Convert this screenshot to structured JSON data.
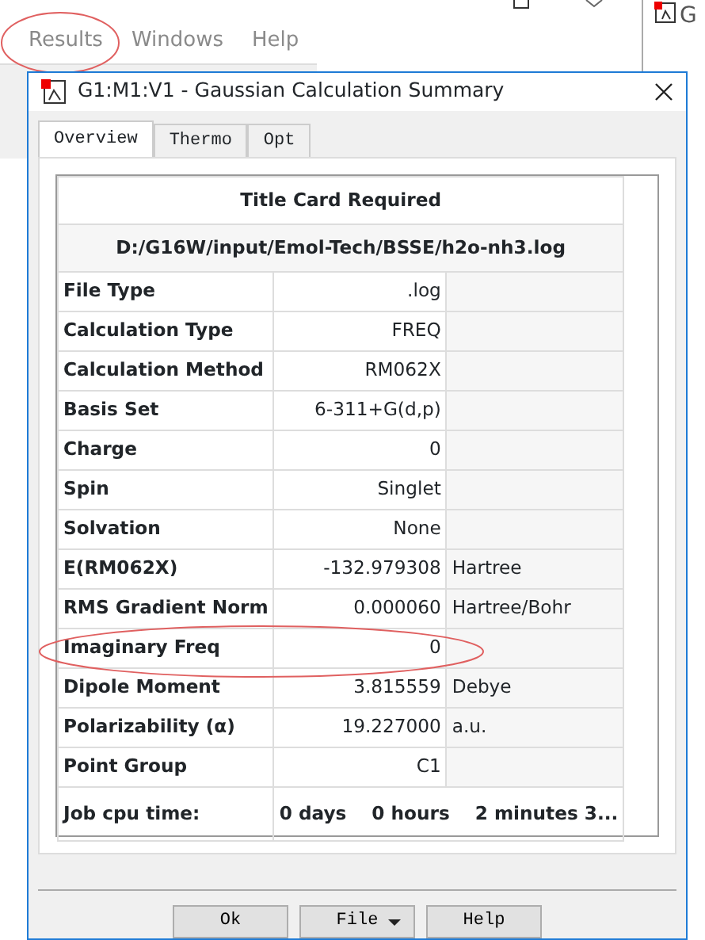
{
  "app_window": {
    "menu": [
      {
        "label": "Results",
        "circled": true
      },
      {
        "label": "Windows",
        "circled": false
      },
      {
        "label": "Help",
        "circled": false
      }
    ]
  },
  "side_window": {
    "title": "G"
  },
  "dialog": {
    "title": "G1:M1:V1 - Gaussian Calculation Summary",
    "tabs": [
      {
        "label": "Overview",
        "selected": true
      },
      {
        "label": "Thermo",
        "selected": false
      },
      {
        "label": "Opt",
        "selected": false
      }
    ],
    "rows": [
      {
        "kind": "header",
        "text": "Title Card Required"
      },
      {
        "kind": "path",
        "text": "D:/G16W/input/Emol-Tech/BSSE/h2o-nh3.log"
      },
      {
        "kind": "field",
        "label": "File Type",
        "value": ".log"
      },
      {
        "kind": "field",
        "label": "Calculation Type",
        "value": "FREQ"
      },
      {
        "kind": "field",
        "label": "Calculation Method",
        "value": "RM062X"
      },
      {
        "kind": "field",
        "label": "Basis Set",
        "value": "6-311+G(d,p)"
      },
      {
        "kind": "field",
        "label": "Charge",
        "value": "0"
      },
      {
        "kind": "field",
        "label": "Spin",
        "value": "Singlet"
      },
      {
        "kind": "field",
        "label": "Solvation",
        "value": "None"
      },
      {
        "kind": "field",
        "label": "E(RM062X)",
        "value": "-132.979308",
        "unit": "Hartree"
      },
      {
        "kind": "field",
        "label": "RMS Gradient Norm",
        "value": "0.000060",
        "unit": "Hartree/Bohr"
      },
      {
        "kind": "field",
        "label": "Imaginary Freq",
        "value": "0",
        "circled": true
      },
      {
        "kind": "field",
        "label": "Dipole Moment",
        "value": "3.815559",
        "unit": "Debye"
      },
      {
        "kind": "field",
        "label": "Polarizability (α)",
        "value": "19.227000",
        "unit": "a.u."
      },
      {
        "kind": "field",
        "label": "Point Group",
        "value": "C1"
      },
      {
        "kind": "time",
        "label": "Job cpu time:",
        "parts": [
          "0 days",
          "0 hours",
          "2 minutes 3..."
        ]
      }
    ],
    "buttons": [
      {
        "label": "Ok",
        "dropdown": false
      },
      {
        "label": "File",
        "dropdown": true
      },
      {
        "label": "Help",
        "dropdown": false
      }
    ]
  }
}
